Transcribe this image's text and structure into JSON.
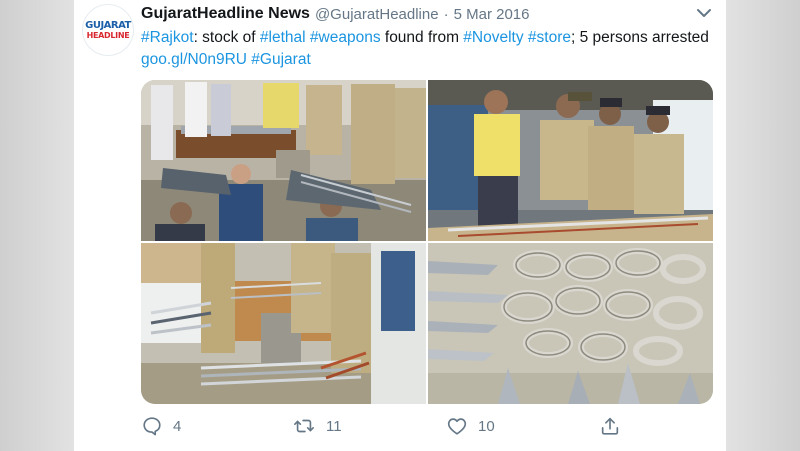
{
  "tweet": {
    "author": {
      "display_name": "GujaratHeadline News",
      "handle": "@GujaratHeadline",
      "logo_top": "GUJARAT",
      "logo_bottom": "HEADLINE"
    },
    "separator": "·",
    "date": "5 Mar 2016",
    "text": {
      "hashtag_rajkot": "#Rajkot",
      "part1": ": stock of ",
      "hashtag_lethal": "#lethal",
      "space1": " ",
      "hashtag_weapons": "#weapons",
      "part2": " found from ",
      "hashtag_novelty": "#Novelty",
      "space2": " ",
      "hashtag_store": "#store",
      "part3": "; 5 persons arrested ",
      "link": "goo.gl/N0n9RU",
      "space3": " ",
      "hashtag_gujarat": "#Gujarat"
    },
    "metrics": {
      "replies": "4",
      "retweets": "11",
      "likes": "10"
    }
  },
  "colors": {
    "link": "#1b95e0",
    "text": "#14171a",
    "muted": "#657786",
    "logo_blue": "#1b5fa8",
    "logo_red": "#d8282f"
  },
  "icons": [
    "caret-down-icon",
    "reply-icon",
    "retweet-icon",
    "like-icon",
    "share-icon"
  ]
}
